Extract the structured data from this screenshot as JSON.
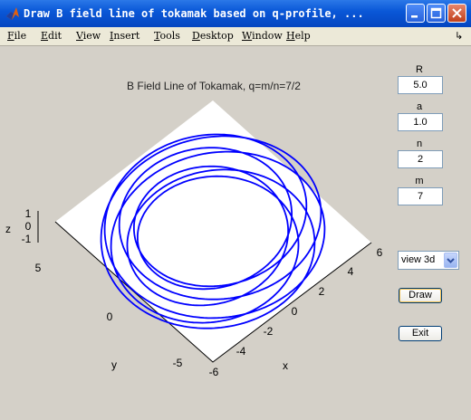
{
  "window": {
    "title": "Draw B field line of tokamak based on q-profile, ...",
    "controls": [
      "minimize-icon",
      "maximize-icon",
      "close-icon"
    ]
  },
  "menu": {
    "items": [
      "File",
      "Edit",
      "View",
      "Insert",
      "Tools",
      "Desktop",
      "Window",
      "Help"
    ],
    "dock_arrow_icon": "arrow-icon"
  },
  "plot": {
    "title": "B Field Line of Tokamak, q=m/n=7/2",
    "xlabel": "x",
    "ylabel": "y",
    "zlabel": "z",
    "x_ticks": [
      "-6",
      "-4",
      "-2",
      "0",
      "2",
      "4",
      "6"
    ],
    "y_ticks": [
      "-5",
      "0",
      "5"
    ],
    "z_ticks": [
      "-1",
      "0",
      "1"
    ],
    "line_color": "#0000ff"
  },
  "chart_data": {
    "type": "line",
    "title": "B Field Line of Tokamak, q=m/n=7/2",
    "xlabel": "x",
    "ylabel": "y",
    "zlabel": "z",
    "xlim": [
      -6,
      6
    ],
    "ylim": [
      -6,
      6
    ],
    "zlim": [
      -1,
      1
    ],
    "view": "3d",
    "parameters": {
      "R": 5.0,
      "a": 1.0,
      "n": 2,
      "m": 7
    }
  },
  "controls": {
    "R": {
      "label": "R",
      "value": "5.0"
    },
    "a": {
      "label": "a",
      "value": "1.0"
    },
    "n": {
      "label": "n",
      "value": "2"
    },
    "m": {
      "label": "m",
      "value": "7"
    },
    "view_select": "view 3d",
    "draw_label": "Draw",
    "exit_label": "Exit"
  }
}
